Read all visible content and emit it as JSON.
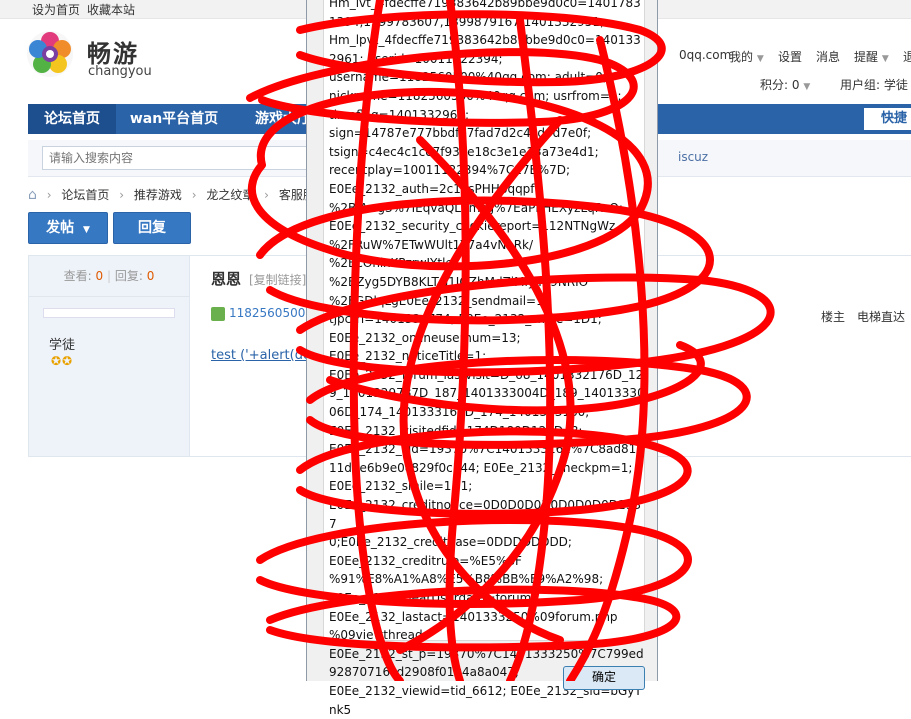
{
  "topbar": {
    "set_home": "设为首页",
    "bookmark": "收藏本站"
  },
  "brand": {
    "name_cn": "畅游",
    "name_en": "changyou"
  },
  "header": {
    "email_tail": "0qq.com",
    "links": [
      "我的",
      "设置",
      "消息",
      "提醒",
      "退"
    ],
    "points_label": "积分: 0",
    "user_group_label": "用户组: 学徒"
  },
  "nav": {
    "tabs": [
      "论坛首页",
      "wan平台首页",
      "游戏大厅"
    ],
    "quick_label": "快捷"
  },
  "search": {
    "placeholder": "请输入搜索内容",
    "hot_word": "iscuz"
  },
  "breadcrumb": [
    "论坛首页",
    "推荐游戏",
    "龙之纹章",
    "客服服"
  ],
  "buttons": {
    "post": "发帖",
    "reply": "回复"
  },
  "post": {
    "views_label": "查看:",
    "views": "0",
    "replies_label": "回复:",
    "replies": "0",
    "title": "恩恩",
    "copy_link": "[复制链接]",
    "author": "1182560500@",
    "floor_owner": "楼主",
    "elevator": "电梯直达",
    "rank": "学徒",
    "content": "test ('+alert(doc"
  },
  "dialog": {
    "cookie_text": "Hm_lvt_4fdecffe719383642b89bbe9d0c0=14017831394,1399783607,1399879167,1401332951;\nHm_lpvt_4fdecffe719383642b89bbe9d0c0=1401332961; userid=10011122394;\nusername=1182560500%40qq.com; adult=0;\nnickname=1182560500%40qq.com; usrfrom=1;\ntimeflag=1401332961;\nsign=14787e777bbdfe7fad7d2c4cd6d7e0f;\ntsign=c4ec4c1ce7f93ee18c3e1e13a73e4d1;\nrecentplay=10011122394%7C17B%7D;\nE0Ee_2132_auth=2c1esPHHpqqpf\n%2BIAwg3%7IEqvaQLnmsg%7EaPFHEXyzLqRzQ;\nE0Ee_2132_security_cookiereport=112NTNgWz\n%2FRuW%7ETwWUlt1Y7a4vNeRk/\n%2BcOnlxKPzrwJYtle\n%2BZyg5DYB8KLTG1IOZhMdZiMly479NRIO\n%2FGDlqLgE0Ee_2132_sendmail=1;\ntjpctrl=1401334774; E0Ee_2132_smile=1D1;\nE0Ee_2132_onlineusernum=13;\nE0Ee_2132_noticeTitle=1;\nE0Ee_2132_forum_lastvisit=D_68_1401332176D_129_1401329787D_187_1401333004D_189_1401333006D_174_1401333160D_174_1401333160;\nE0Ee_2132_visitedfid=174D189D129D48;\nE0Ee_2132_sid=19370%7C1401333162%7C8ad81a11d0e6b9e0c829f0c344; E0Ee_2132_checkpm=1;\nE0Ee_2132_smile=1D1;\nE0Ee_2132_creditnotice=0D0D0D0D0D0D0D0D1937\n0;E0Ee_2132_creditbase=0DDDDDDDD;\nE0Ee_2132_creditrule=%E5%8F\n%91%E8%A1%A8%E5%B8%BB%E9%A2%98;\nE0Ee_2132_clearUserdata=forum;\nE0Ee_2132_lastact=1401333250%09forum.php\n%09viewthread;\nE0Ee_2132_st_p=19370%7C1401333250%7C799ed92870716cd2908f0104a8a047;\nE0Ee_2132_viewid=tid_6612; E0Ee_2132_sid=bGyTnk5",
    "ok_label": "确定"
  },
  "colors": {
    "nav_blue": "#2a63a8",
    "scribble_red": "#ff0000",
    "accent_orange": "#e05a00"
  }
}
